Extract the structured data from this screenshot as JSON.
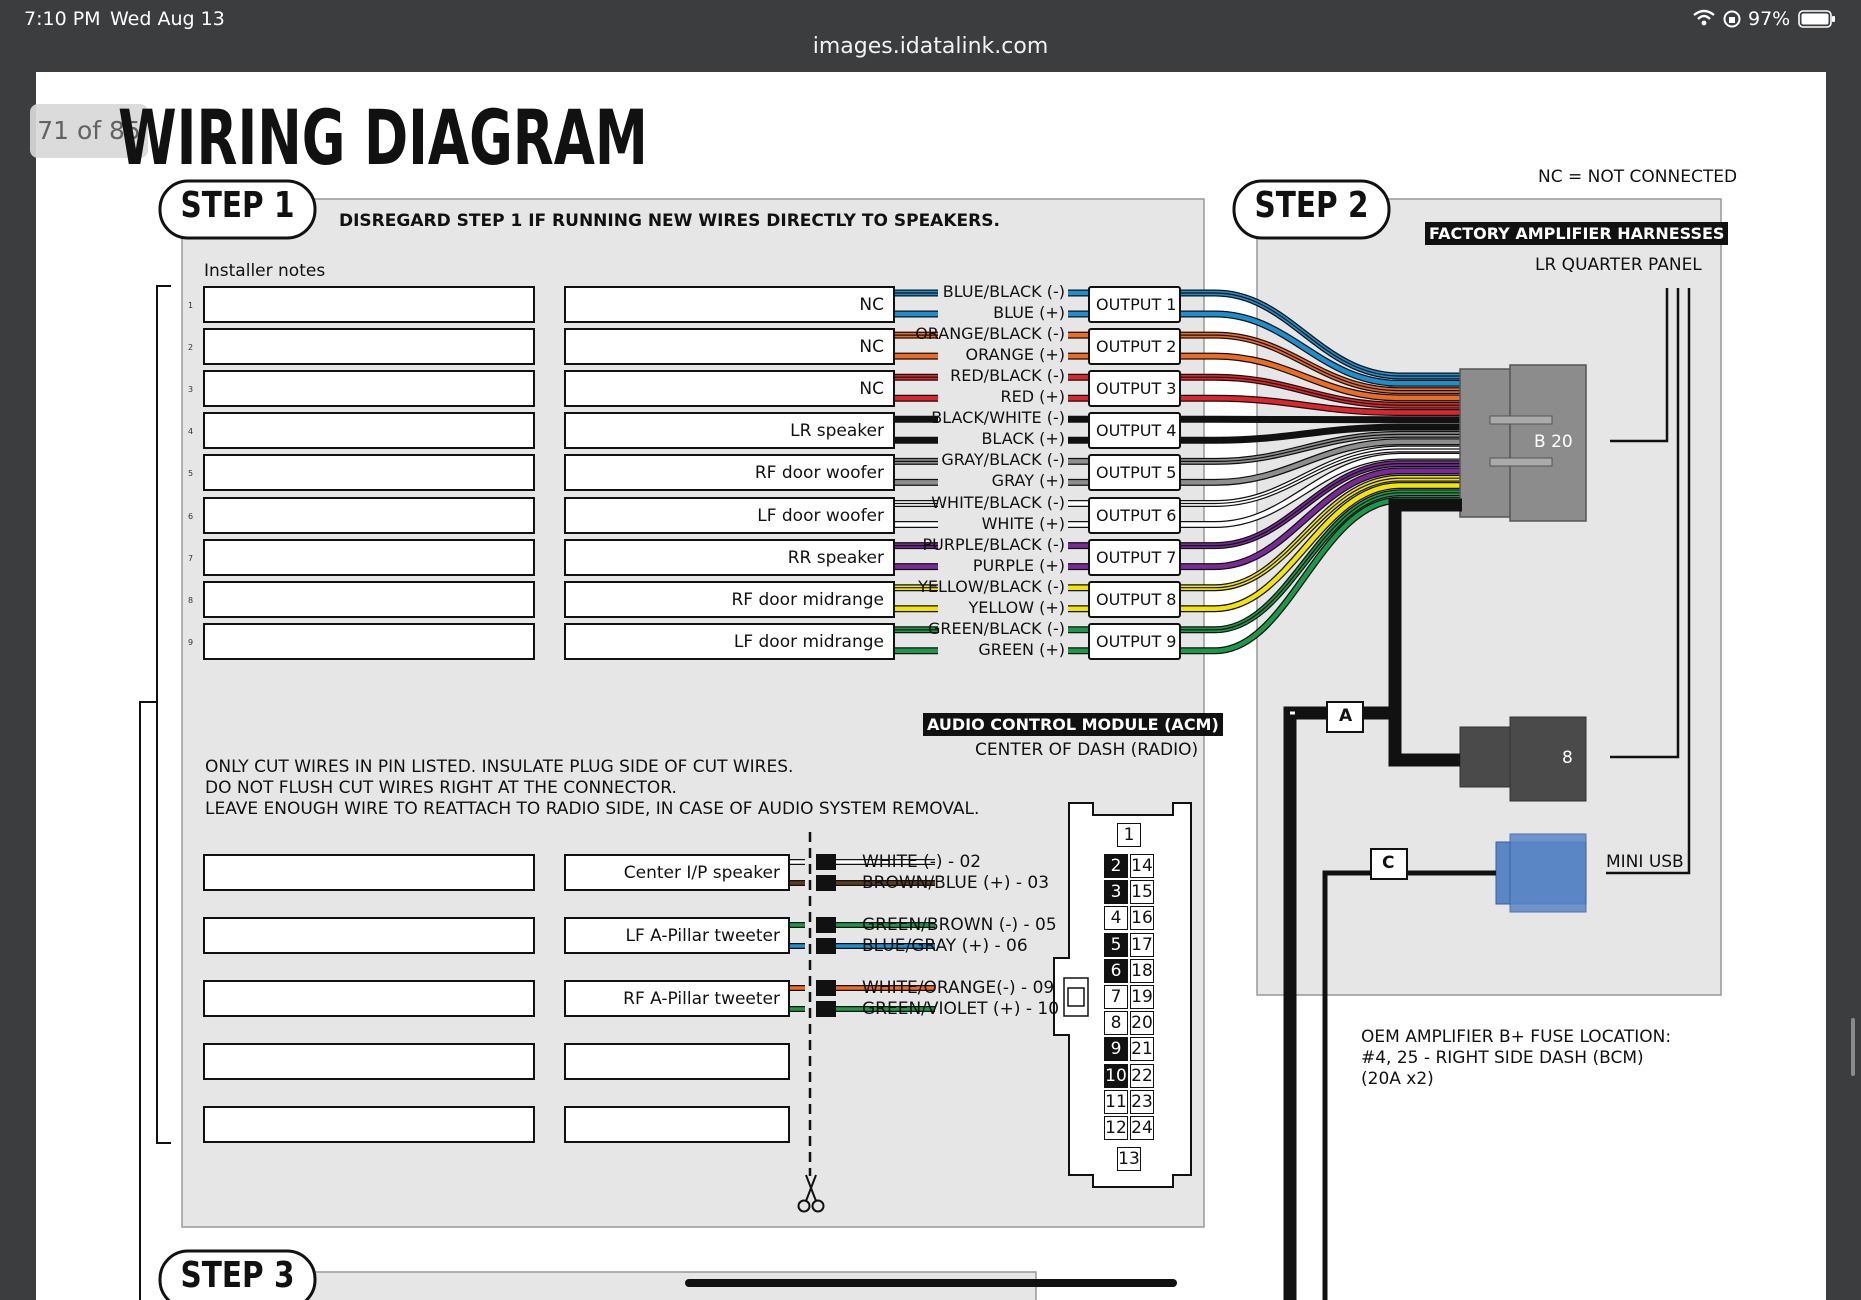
{
  "status_bar": {
    "time": "7:10 PM",
    "date": "Wed Aug 13",
    "battery": "97%"
  },
  "browser": {
    "url": "images.idatalink.com"
  },
  "viewer": {
    "page_counter": "71 of 85"
  },
  "diagram": {
    "title": "WIRING DIAGRAM",
    "nc_note": "NC = NOT CONNECTED",
    "step1": {
      "label": "STEP 1",
      "disregard_note": "DISREGARD STEP 1 IF RUNNING NEW WIRES DIRECTLY TO SPEAKERS.",
      "installer_notes": "Installer notes",
      "rows": [
        {
          "num": "1",
          "label": "NC",
          "wire_neg": "BLUE/BLACK (-)",
          "wire_pos": "BLUE (+)",
          "output": "OUTPUT 1",
          "neg_color": "#1d8fd1",
          "pos_color": "#1d8fd1"
        },
        {
          "num": "2",
          "label": "NC",
          "wire_neg": "ORANGE/BLACK (-)",
          "wire_pos": "ORANGE (+)",
          "output": "OUTPUT 2",
          "neg_color": "#ef6b22",
          "pos_color": "#ef6b22"
        },
        {
          "num": "3",
          "label": "NC",
          "wire_neg": "RED/BLACK (-)",
          "wire_pos": "RED (+)",
          "output": "OUTPUT 3",
          "neg_color": "#e0242b",
          "pos_color": "#e0242b"
        },
        {
          "num": "4",
          "label": "LR speaker",
          "wire_neg": "BLACK/WHITE (-)",
          "wire_pos": "BLACK (+)",
          "output": "OUTPUT 4",
          "neg_color": "#111111",
          "pos_color": "#111111"
        },
        {
          "num": "5",
          "label": "RF door woofer",
          "wire_neg": "GRAY/BLACK (-)",
          "wire_pos": "GRAY (+)",
          "output": "OUTPUT 5",
          "neg_color": "#8e8e8e",
          "pos_color": "#8e8e8e"
        },
        {
          "num": "6",
          "label": "LF door woofer",
          "wire_neg": "WHITE/BLACK (-)",
          "wire_pos": "WHITE (+)",
          "output": "OUTPUT 6",
          "neg_color": "#ffffff",
          "pos_color": "#ffffff"
        },
        {
          "num": "7",
          "label": "RR speaker",
          "wire_neg": "PURPLE/BLACK (-)",
          "wire_pos": "PURPLE (+)",
          "output": "OUTPUT 7",
          "neg_color": "#7a2a98",
          "pos_color": "#7a2a98"
        },
        {
          "num": "8",
          "label": "RF door midrange",
          "wire_neg": "YELLOW/BLACK (-)",
          "wire_pos": "YELLOW (+)",
          "output": "OUTPUT 8",
          "neg_color": "#f2e600",
          "pos_color": "#f2e600"
        },
        {
          "num": "9",
          "label": "LF door midrange",
          "wire_neg": "GREEN/BLACK (-)",
          "wire_pos": "GREEN (+)",
          "output": "OUTPUT 9",
          "neg_color": "#1a9a48",
          "pos_color": "#1a9a48"
        }
      ]
    },
    "acm": {
      "title": "AUDIO CONTROL MODULE (ACM)",
      "location": "CENTER OF DASH (RADIO)",
      "instructions": [
        "ONLY CUT WIRES IN PIN LISTED. INSULATE PLUG SIDE OF CUT WIRES.",
        "DO NOT FLUSH CUT WIRES RIGHT AT THE CONNECTOR.",
        "LEAVE ENOUGH WIRE TO REATTACH TO RADIO SIDE, IN CASE OF AUDIO SYSTEM REMOVAL."
      ],
      "cut_rows": [
        {
          "label": "Center I/P speaker",
          "wire_1": "WHITE (-) - 02",
          "wire_2": "BROWN/BLUE (+) - 03",
          "color_1": "#ffffff",
          "color_2": "#5b3a1f"
        },
        {
          "label": "LF A-Pillar tweeter",
          "wire_1": "GREEN/BROWN (-) - 05",
          "wire_2": "BLUE/GRAY (+) - 06",
          "color_1": "#1a9a48",
          "color_2": "#1d8fd1"
        },
        {
          "label": "RF A-Pillar tweeter",
          "wire_1": "WHITE/ORANGE(-) - 09",
          "wire_2": "GREEN/VIOLET (+) - 10",
          "color_1": "#ef6b22",
          "color_2": "#1a9a48"
        },
        {
          "label": ""
        },
        {
          "label": ""
        }
      ],
      "connector_top_pin": "1",
      "connector_bottom_pin": "13",
      "connector_pins": [
        {
          "left": "2",
          "right": "14",
          "left_dark": true
        },
        {
          "left": "3",
          "right": "15",
          "left_dark": true
        },
        {
          "left": "4",
          "right": "16",
          "left_dark": false
        },
        {
          "left": "5",
          "right": "17",
          "left_dark": true
        },
        {
          "left": "6",
          "right": "18",
          "left_dark": true
        },
        {
          "left": "7",
          "right": "19",
          "left_dark": false
        },
        {
          "left": "8",
          "right": "20",
          "left_dark": false
        },
        {
          "left": "9",
          "right": "21",
          "left_dark": true
        },
        {
          "left": "10",
          "right": "22",
          "left_dark": true
        },
        {
          "left": "11",
          "right": "23",
          "left_dark": false
        },
        {
          "left": "12",
          "right": "24",
          "left_dark": false
        }
      ]
    },
    "step2": {
      "label": "STEP 2",
      "harness_title": "FACTORY AMPLIFIER HARNESSES",
      "location": "LR QUARTER PANEL",
      "connector_b": "B  20",
      "connector_8": "8",
      "mini_usb": "MINI USB",
      "marker_a": "A",
      "marker_c": "C"
    },
    "fuse_note": [
      "OEM AMPLIFIER B+ FUSE LOCATION:",
      "#4, 25 - RIGHT SIDE DASH (BCM)",
      "(20A x2)"
    ],
    "step3": {
      "label": "STEP 3"
    }
  },
  "colors": {
    "panel_gray": "#e6e6e6",
    "harness_gray": "#8c8c8c",
    "mini_usb_blue": "#5b86c6",
    "browser_chrome": "#3b3d3e"
  }
}
